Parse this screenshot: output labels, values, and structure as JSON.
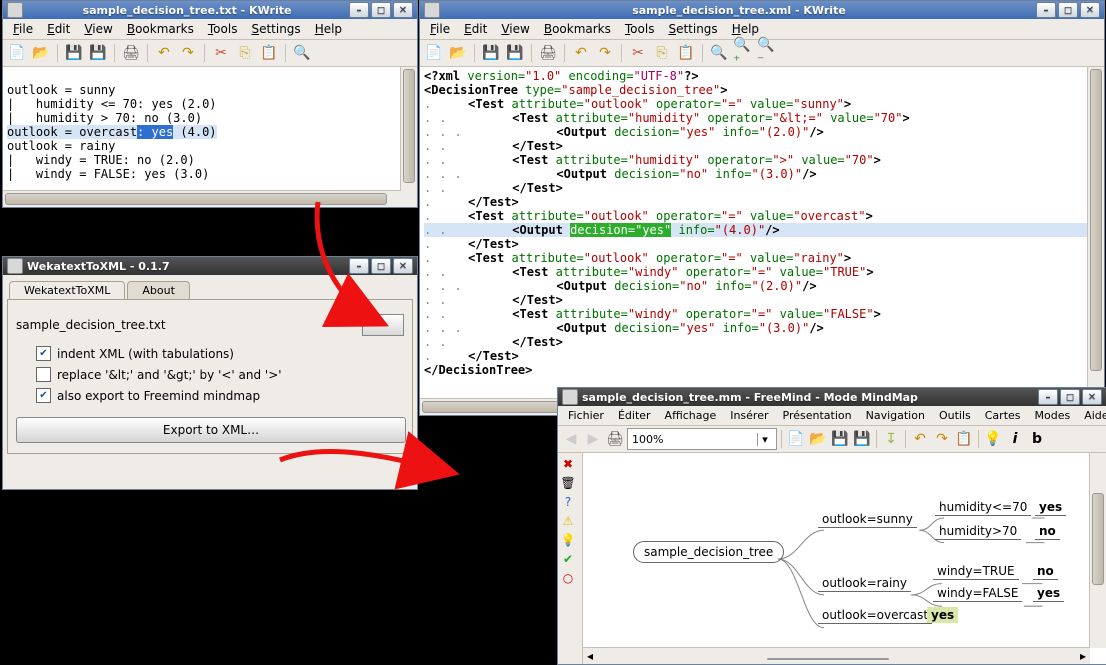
{
  "txt": {
    "title": "sample_decision_tree.txt - KWrite",
    "menu": [
      "File",
      "Edit",
      "View",
      "Bookmarks",
      "Tools",
      "Settings",
      "Help"
    ],
    "lines": [
      "outlook = sunny",
      "|   humidity <= 70: yes (2.0)",
      "|   humidity > 70: no (3.0)",
      "outlook = overcast: yes (4.0)",
      "outlook = rainy",
      "|   windy = TRUE: no (2.0)",
      "|   windy = FALSE: yes (3.0)"
    ],
    "hl_prefix": "outlook = overcast",
    "hl_sel": ": yes",
    "hl_suffix": " (4.0)"
  },
  "xml": {
    "title": "sample_decision_tree.xml - KWrite",
    "menu": [
      "File",
      "Edit",
      "View",
      "Bookmarks",
      "Tools",
      "Settings",
      "Help"
    ],
    "hl_output_decision": "yes",
    "hl_output_info": "(4.0)"
  },
  "wtx": {
    "title": "WekatextToXML - 0.1.7",
    "tabs": [
      "WekatextToXML",
      "About"
    ],
    "file": "sample_decision_tree.txt",
    "browse": "…",
    "opt1": "indent XML (with tabulations)",
    "opt1_checked": true,
    "opt2": "replace '&lt;' and '&gt;' by '<' and '>'",
    "opt2_checked": false,
    "opt3": "also export to Freemind mindmap",
    "opt3_checked": true,
    "export": "Export to XML…"
  },
  "fm": {
    "title": "sample_decision_tree.mm - FreeMind - Mode MindMap",
    "menu": [
      "Fichier",
      "Éditer",
      "Affichage",
      "Insérer",
      "Présentation",
      "Navigation",
      "Outils",
      "Cartes",
      "Modes",
      "Aide"
    ],
    "zoom": "100%",
    "root": "sample_decision_tree",
    "b_sunny": "outlook=sunny",
    "b_rainy": "outlook=rainy",
    "b_overcast": "outlook=overcast",
    "b_hum_le": "humidity<=70",
    "b_hum_gt": "humidity>70",
    "b_windy_t": "windy=TRUE",
    "b_windy_f": "windy=FALSE",
    "l_yes": "yes",
    "l_no": "no",
    "badge_yes": "yes"
  }
}
